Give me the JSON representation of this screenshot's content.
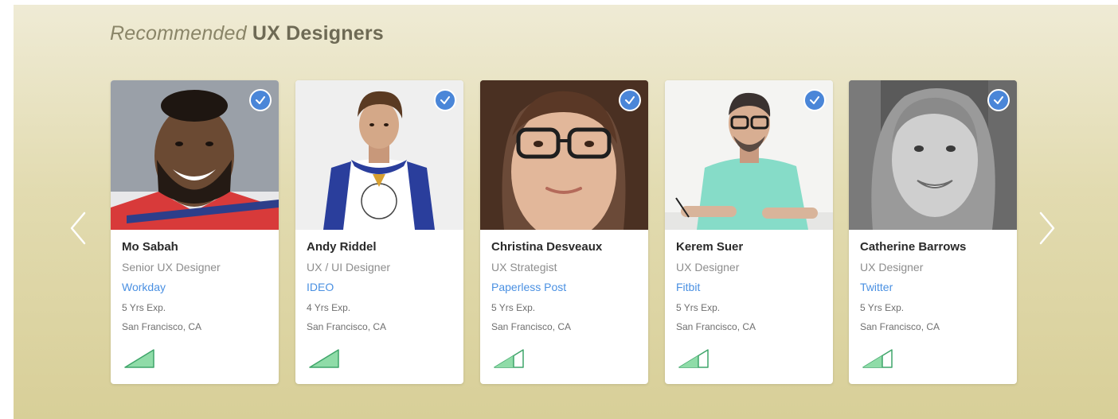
{
  "section": {
    "title_lead": "Recommended",
    "title_strong": "UX Designers"
  },
  "nav": {
    "prev_icon": "chevron-left-icon",
    "next_icon": "chevron-right-icon"
  },
  "colors": {
    "company_link": "#4a90e2",
    "verified_badge": "#4a86d8",
    "level_fill": "#8fdca8",
    "level_stroke": "#3fa56a"
  },
  "designers": [
    {
      "name": "Mo Sabah",
      "role": "Senior UX Designer",
      "company": "Workday",
      "experience": "5 Yrs Exp.",
      "location": "San Francisco, CA",
      "verified": true,
      "level": 0.5
    },
    {
      "name": "Andy Riddel",
      "role": "UX / UI Designer",
      "company": "IDEO",
      "experience": "4 Yrs Exp.",
      "location": "San Francisco, CA",
      "verified": true,
      "level": 0.5
    },
    {
      "name": "Christina Desveaux",
      "role": "UX Strategist",
      "company": "Paperless Post",
      "experience": "5 Yrs Exp.",
      "location": "San Francisco, CA",
      "verified": true,
      "level": 0.67
    },
    {
      "name": "Kerem Suer",
      "role": "UX Designer",
      "company": "Fitbit",
      "experience": "5 Yrs Exp.",
      "location": "San Francisco, CA",
      "verified": true,
      "level": 0.67
    },
    {
      "name": "Catherine Barrows",
      "role": "UX Designer",
      "company": "Twitter",
      "experience": "5 Yrs Exp.",
      "location": "San Francisco, CA",
      "verified": true,
      "level": 0.67
    }
  ]
}
